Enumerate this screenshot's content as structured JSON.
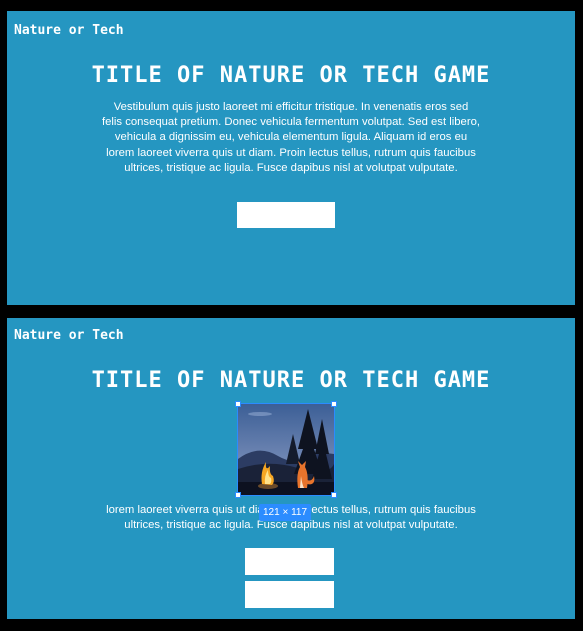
{
  "brand": "Nature or Tech",
  "title": "TITLE OF NATURE OR TECH GAME",
  "intro_lines": [
    "Vestibulum quis justo laoreet mi efficitur tristique. In venenatis eros sed",
    "felis consequat pretium. Donec vehicula fermentum volutpat. Sed est libero,",
    "vehicula a dignissim eu, vehicula elementum ligula. Aliquam id eros eu",
    "lorem laoreet viverra quis ut diam. Proin lectus tellus, rutrum quis faucibus",
    "ultrices, tristique ac ligula. Fusce dapibus nisl at volutpat vulputate."
  ],
  "game_text_lines": [
    "lorem laoreet viverra quis ut diam. Proin lectus tellus, rutrum quis faucibus",
    "ultrices, tristique ac ligula. Fusce dapibus nisl at volutpat vulputate."
  ],
  "image": {
    "size_label": "121 × 117"
  },
  "colors": {
    "panel": "#2596c1",
    "background": "#000000",
    "selection": "#2b8cff"
  }
}
